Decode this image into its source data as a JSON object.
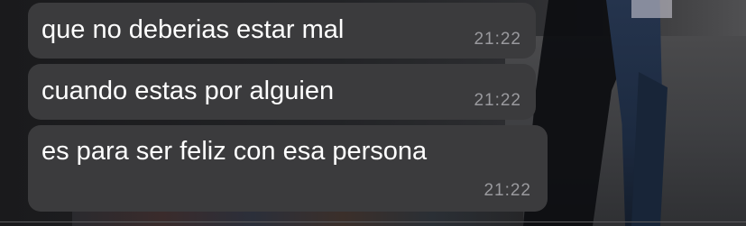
{
  "chat": {
    "messages": [
      {
        "text": "que no deberias estar mal",
        "time": "21:22"
      },
      {
        "text": "cuando estas por alguien",
        "time": "21:22"
      },
      {
        "text": "es para ser feliz con esa persona",
        "time": "21:22"
      }
    ]
  },
  "colors": {
    "bubble_background": "#3b3b3d",
    "message_text": "#ffffff",
    "timestamp_text": "#9a9a9e"
  }
}
